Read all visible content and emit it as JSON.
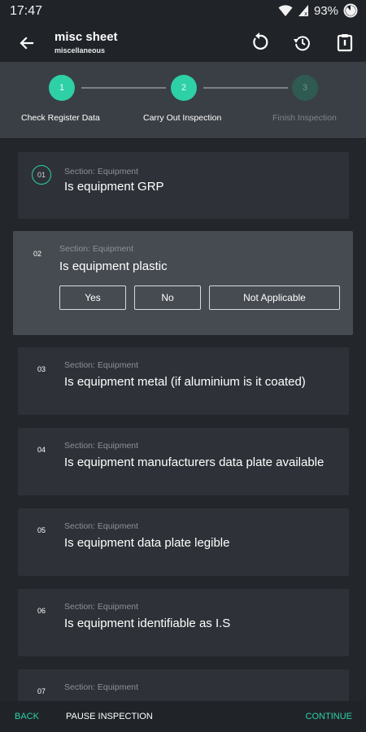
{
  "status_bar": {
    "time": "17:47",
    "battery": "93%"
  },
  "app_bar": {
    "title": "misc sheet",
    "subtitle": "miscellaneous"
  },
  "stepper": {
    "steps": [
      {
        "number": "1",
        "label": "Check Register Data"
      },
      {
        "number": "2",
        "label": "Carry Out Inspection"
      },
      {
        "number": "3",
        "label": "Finish Inspection"
      }
    ]
  },
  "questions": [
    {
      "number": "01",
      "section": "Section: Equipment",
      "text": "Is equipment GRP"
    },
    {
      "number": "02",
      "section": "Section: Equipment",
      "text": "Is equipment plastic"
    },
    {
      "number": "03",
      "section": "Section: Equipment",
      "text": "Is equipment metal (if aluminium is it coated)"
    },
    {
      "number": "04",
      "section": "Section: Equipment",
      "text": "Is equipment manufacturers data plate available"
    },
    {
      "number": "05",
      "section": "Section: Equipment",
      "text": "Is equipment data plate legible"
    },
    {
      "number": "06",
      "section": "Section: Equipment",
      "text": "Is equipment identifiable as I.S"
    },
    {
      "number": "07",
      "section": "Section: Equipment",
      "text": ""
    }
  ],
  "answer_options": {
    "yes": "Yes",
    "no": "No",
    "na": "Not Applicable"
  },
  "bottom_bar": {
    "back": "BACK",
    "pause": "PAUSE INSPECTION",
    "continue": "CONTINUE"
  },
  "colors": {
    "accent": "#2ed0a6",
    "background": "#23272c",
    "card": "#2e3238",
    "active_card": "#464b51"
  },
  "icons": {
    "back": "arrow-left-icon",
    "reset": "reset-icon",
    "history": "history-icon",
    "clipboard": "clipboard-icon"
  }
}
